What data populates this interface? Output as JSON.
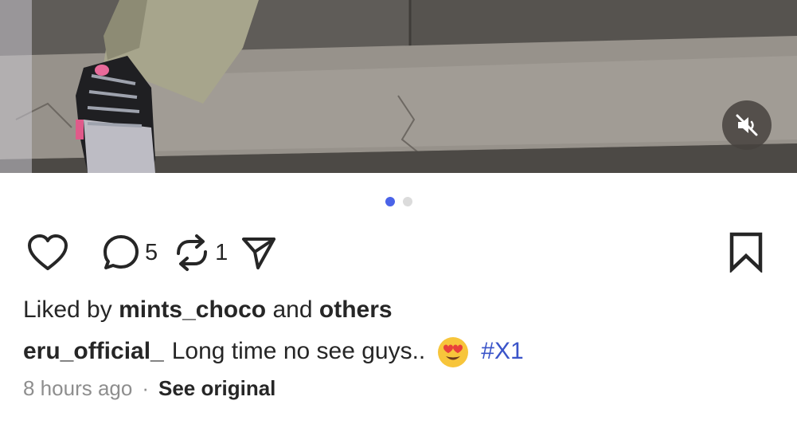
{
  "media": {
    "description_icons": {
      "mute": "speaker-muted-icon"
    },
    "carousel": {
      "total": 2,
      "active_index": 0
    }
  },
  "actions": {
    "comment_count": "5",
    "repost_count": "1"
  },
  "likes": {
    "prefix": "Liked by",
    "user": "mints_choco",
    "connector": "and",
    "others": "others"
  },
  "caption": {
    "username": "eru_official_",
    "text": "Long time no see guys..",
    "emoji": "😍",
    "hashtag": "#X1"
  },
  "meta": {
    "time": "8 hours ago",
    "separator": "·",
    "see_original": "See original"
  },
  "colors": {
    "accent_dot": "#4a63e8",
    "hashtag": "#3a54c9",
    "text": "#262626",
    "muted_text": "#8e8e8e"
  }
}
